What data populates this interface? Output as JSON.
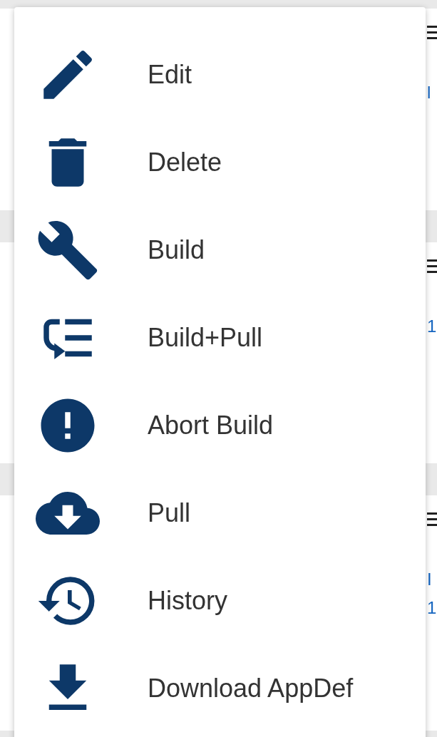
{
  "background_cards": [
    {
      "lines": [
        "l"
      ]
    },
    {
      "lines": [
        "1"
      ]
    },
    {
      "lines": [
        "I",
        "1"
      ]
    }
  ],
  "menu": {
    "items": [
      {
        "label": "Edit"
      },
      {
        "label": "Delete"
      },
      {
        "label": "Build"
      },
      {
        "label": "Build+Pull"
      },
      {
        "label": "Abort Build"
      },
      {
        "label": "Pull"
      },
      {
        "label": "History"
      },
      {
        "label": "Download AppDef"
      }
    ]
  }
}
